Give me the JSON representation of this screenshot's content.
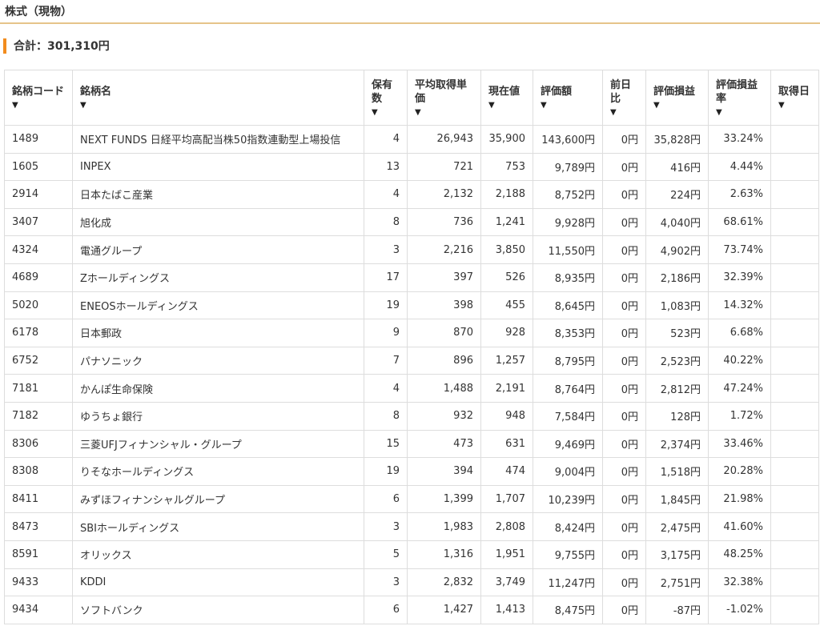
{
  "section_title": "株式（現物）",
  "total": {
    "label": "合計：",
    "value": "301,310円"
  },
  "sort_icon": "▼",
  "columns": [
    [
      "銘柄コード"
    ],
    [
      "銘柄名"
    ],
    [
      "保有",
      "数"
    ],
    [
      "平均取得単",
      "価"
    ],
    [
      "現在値"
    ],
    [
      "評価額"
    ],
    [
      "前日",
      "比"
    ],
    [
      "評価損益"
    ],
    [
      "評価損益",
      "率"
    ],
    [
      "取得日"
    ]
  ],
  "rows": [
    [
      "1489",
      "NEXT FUNDS 日経平均高配当株50指数連動型上場投信",
      "4",
      "26,943",
      "35,900",
      "143,600円",
      "0円",
      "35,828円",
      "33.24%",
      ""
    ],
    [
      "1605",
      "INPEX",
      "13",
      "721",
      "753",
      "9,789円",
      "0円",
      "416円",
      "4.44%",
      ""
    ],
    [
      "2914",
      "日本たばこ産業",
      "4",
      "2,132",
      "2,188",
      "8,752円",
      "0円",
      "224円",
      "2.63%",
      ""
    ],
    [
      "3407",
      "旭化成",
      "8",
      "736",
      "1,241",
      "9,928円",
      "0円",
      "4,040円",
      "68.61%",
      ""
    ],
    [
      "4324",
      "電通グループ",
      "3",
      "2,216",
      "3,850",
      "11,550円",
      "0円",
      "4,902円",
      "73.74%",
      ""
    ],
    [
      "4689",
      "Zホールディングス",
      "17",
      "397",
      "526",
      "8,935円",
      "0円",
      "2,186円",
      "32.39%",
      ""
    ],
    [
      "5020",
      "ENEOSホールディングス",
      "19",
      "398",
      "455",
      "8,645円",
      "0円",
      "1,083円",
      "14.32%",
      ""
    ],
    [
      "6178",
      "日本郵政",
      "9",
      "870",
      "928",
      "8,353円",
      "0円",
      "523円",
      "6.68%",
      ""
    ],
    [
      "6752",
      "パナソニック",
      "7",
      "896",
      "1,257",
      "8,795円",
      "0円",
      "2,523円",
      "40.22%",
      ""
    ],
    [
      "7181",
      "かんぽ生命保険",
      "4",
      "1,488",
      "2,191",
      "8,764円",
      "0円",
      "2,812円",
      "47.24%",
      ""
    ],
    [
      "7182",
      "ゆうちょ銀行",
      "8",
      "932",
      "948",
      "7,584円",
      "0円",
      "128円",
      "1.72%",
      ""
    ],
    [
      "8306",
      "三菱UFJフィナンシャル・グループ",
      "15",
      "473",
      "631",
      "9,469円",
      "0円",
      "2,374円",
      "33.46%",
      ""
    ],
    [
      "8308",
      "りそなホールディングス",
      "19",
      "394",
      "474",
      "9,004円",
      "0円",
      "1,518円",
      "20.28%",
      ""
    ],
    [
      "8411",
      "みずほフィナンシャルグループ",
      "6",
      "1,399",
      "1,707",
      "10,239円",
      "0円",
      "1,845円",
      "21.98%",
      ""
    ],
    [
      "8473",
      "SBIホールディングス",
      "3",
      "1,983",
      "2,808",
      "8,424円",
      "0円",
      "2,475円",
      "41.60%",
      ""
    ],
    [
      "8591",
      "オリックス",
      "5",
      "1,316",
      "1,951",
      "9,755円",
      "0円",
      "3,175円",
      "48.25%",
      ""
    ],
    [
      "9433",
      "KDDI",
      "3",
      "2,832",
      "3,749",
      "11,247円",
      "0円",
      "2,751円",
      "32.38%",
      ""
    ],
    [
      "9434",
      "ソフトバンク",
      "6",
      "1,427",
      "1,413",
      "8,475円",
      "0円",
      "-87円",
      "-1.02%",
      ""
    ]
  ]
}
